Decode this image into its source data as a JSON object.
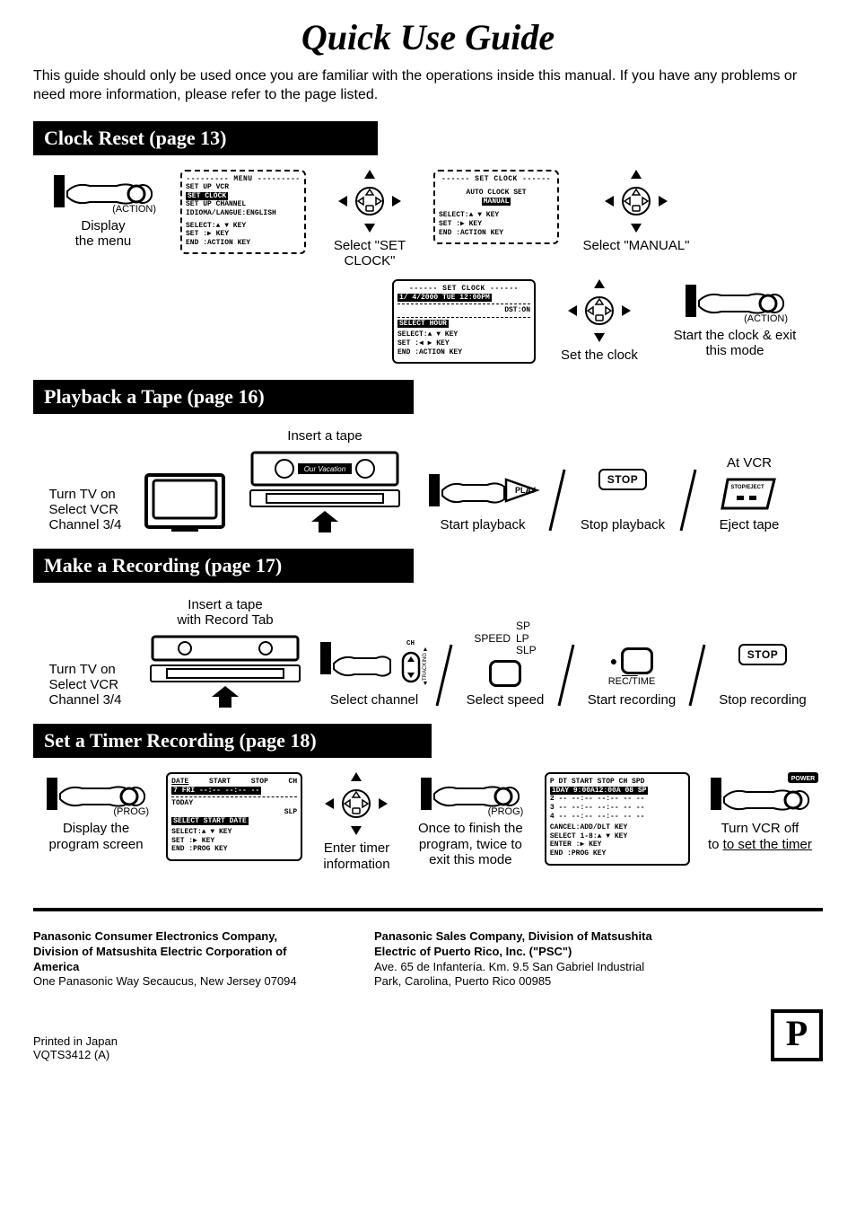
{
  "title": "Quick Use Guide",
  "intro": "This guide should only be used once you are familiar with the operations inside this manual. If you have any problems or need more information, please refer to the page listed.",
  "sections": {
    "clock_reset": {
      "heading": "Clock Reset (page 13)",
      "step1": {
        "button_label": "(ACTION)",
        "caption": "Display the menu"
      },
      "menu1": {
        "title": "--------- MENU ---------",
        "items": [
          "SET UP VCR",
          "SET CLOCK",
          "SET UP CHANNEL",
          "IDIOMA/LANGUE:ENGLISH"
        ],
        "highlighted": 1,
        "footer": [
          "SELECT:▲ ▼ KEY",
          "SET   :▶ KEY",
          "END   :ACTION KEY"
        ]
      },
      "step2": {
        "caption": "Select \"SET CLOCK\""
      },
      "menu2": {
        "title": "------ SET CLOCK ------",
        "items": [
          "AUTO CLOCK SET",
          "MANUAL"
        ],
        "highlighted": 1,
        "footer": [
          "SELECT:▲ ▼ KEY",
          "SET   :▶ KEY",
          "END   :ACTION KEY"
        ]
      },
      "step3": {
        "caption": "Select \"MANUAL\""
      },
      "menu3": {
        "title": "------ SET CLOCK ------",
        "datetime": "1/ 4/2000 TUE 12:00PM",
        "dst": "DST:ON",
        "select_hour": "SELECT HOUR",
        "footer": [
          "SELECT:▲ ▼ KEY",
          "SET   :◀ ▶ KEY",
          "END   :ACTION KEY"
        ]
      },
      "step4": {
        "caption": "Set the clock"
      },
      "step5": {
        "button_label": "(ACTION)",
        "caption": "Start the clock & exit this mode"
      }
    },
    "playback": {
      "heading": "Playback a Tape (page 16)",
      "tv_caption": "Turn TV on\nSelect VCR\nChannel 3/4",
      "insert_tape": "Insert a tape",
      "tape_label": "Our Vacation",
      "play": {
        "button": "PLAY",
        "caption": "Start playback"
      },
      "stop": {
        "button": "STOP",
        "caption": "Stop playback"
      },
      "eject": {
        "at_vcr": "At VCR",
        "btn": "STOP/EJECT",
        "caption": "Eject tape"
      }
    },
    "recording": {
      "heading": "Make a Recording (page 17)",
      "tv_caption": "Turn TV on\nSelect VCR\nChannel 3/4",
      "insert_tape": "Insert a tape\nwith Record Tab",
      "ch_label": "CH",
      "tracking_label": "TRACKING",
      "step_channel": "Select channel",
      "speed_label": "SPEED",
      "speeds": [
        "SP",
        "LP",
        "SLP"
      ],
      "step_speed": "Select speed",
      "rec_label": "REC/TIME",
      "step_rec": "Start recording",
      "stop_btn": "STOP",
      "step_stop": "Stop recording"
    },
    "timer": {
      "heading": "Set a Timer Recording (page 18)",
      "step1": {
        "button_label": "(PROG)",
        "caption": "Display the program screen"
      },
      "menu1": {
        "header": [
          "DATE",
          "START",
          "STOP",
          "CH"
        ],
        "rows": [
          "7 FRI --:--    --:--  --",
          "TODAY",
          "SLP"
        ],
        "select_line": "SELECT START DATE",
        "footer": [
          "SELECT:▲ ▼ KEY",
          "SET   :▶ KEY",
          "END   :PROG KEY"
        ]
      },
      "step2": {
        "caption": "Enter timer information"
      },
      "step3": {
        "button_label": "(PROG)",
        "caption": "Once to finish the program, twice to exit this mode"
      },
      "menu2": {
        "header": "P DT START  STOP  CH SPD",
        "row1": "1DAY  9:00A12:00A 08  SP",
        "rows_blank": [
          "2 -- --:--  --:-- -- --",
          "3 -- --:--  --:-- -- --",
          "4 -- --:--  --:-- -- --"
        ],
        "footer": [
          "CANCEL:ADD/DLT KEY",
          "SELECT 1-8:▲ ▼ KEY",
          "ENTER :▶ KEY",
          "END   :PROG KEY"
        ]
      },
      "step4": {
        "power_label": "POWER",
        "caption_a": "Turn VCR off",
        "caption_b": "to set the timer"
      }
    }
  },
  "footer": {
    "col1_bold": "Panasonic Consumer Electronics Company, Division of Matsushita Electric Corporation of America",
    "col1_addr": "One Panasonic Way Secaucus, New Jersey 07094",
    "col2_bold": "Panasonic Sales Company, Division of Matsushita Electric of Puerto Rico, Inc. (\"PSC\")",
    "col2_addr": "Ave. 65 de Infantería. Km. 9.5 San Gabriel Industrial Park, Carolina, Puerto Rico 00985",
    "printed": "Printed in Japan",
    "code": "VQTS3412 (A)",
    "p_mark": "P"
  }
}
